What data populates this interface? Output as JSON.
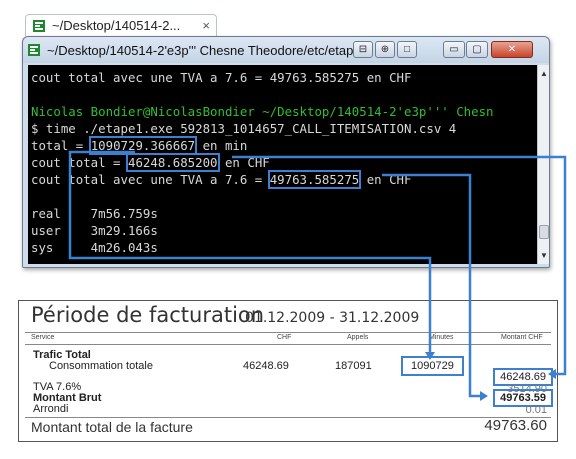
{
  "outer_tab": {
    "title": "~/Desktop/140514-2...",
    "close": "×"
  },
  "window": {
    "title": "~/Desktop/140514-2'e3p''' Chesne Theodore/etc/etape1",
    "buttons": {
      "b1": "⊟",
      "b2": "⊕",
      "b3": "□",
      "minimize": "▭",
      "maximize": "▢",
      "close": "✕"
    }
  },
  "console": {
    "lines": [
      "cout total avec une TVA a 7.6 = 49763.585275 en CHF",
      "",
      "Nicolas Bondier@NicolasBondier ~/Desktop/140514-2'e3p''' Chesn",
      "$ time ./etape1.exe 592813_1014657_CALL_ITEMISATION.csv 4",
      "",
      "",
      "",
      "",
      "real    7m56.759s",
      "user    3m29.166s",
      "sys     4m26.043s"
    ],
    "total_prefix": "total = ",
    "total_value": "1090729.366667",
    "total_suffix": " en min",
    "cout_prefix": "cout total = ",
    "cout_value": "46248.685200",
    "cout_suffix": " en CHF",
    "tva_prefix": "cout total avec une TVA a 7.6 = ",
    "tva_value": "49763.585275",
    "tva_suffix": " en CHF"
  },
  "invoice": {
    "title": "Période de facturation",
    "period": "01.12.2009 - 31.12.2009",
    "headers": {
      "service": "Service",
      "chf": "CHF",
      "appels": "Appels",
      "minutes": "Minutes",
      "montant": "Montant CHF"
    },
    "trafic_total": "Trafic Total",
    "consommation_label": "Consommation totale",
    "consommation_chf": "46248.69",
    "consommation_appels": "187091",
    "consommation_minutes": "1090729",
    "montant_trafic": "46248.69",
    "tva_label": "TVA 7.6%",
    "tva_value": "3514.90",
    "brut_label": "Montant Brut",
    "brut_value": "49763.59",
    "arrondi_label": "Arrondi",
    "arrondi_value": "0.01",
    "total_label": "Montant total de la facture",
    "total_value": "49763.60"
  },
  "colors": {
    "highlight": "#3d7fd0",
    "prompt_green": "#2fbf2f",
    "console_bg": "#000000"
  }
}
